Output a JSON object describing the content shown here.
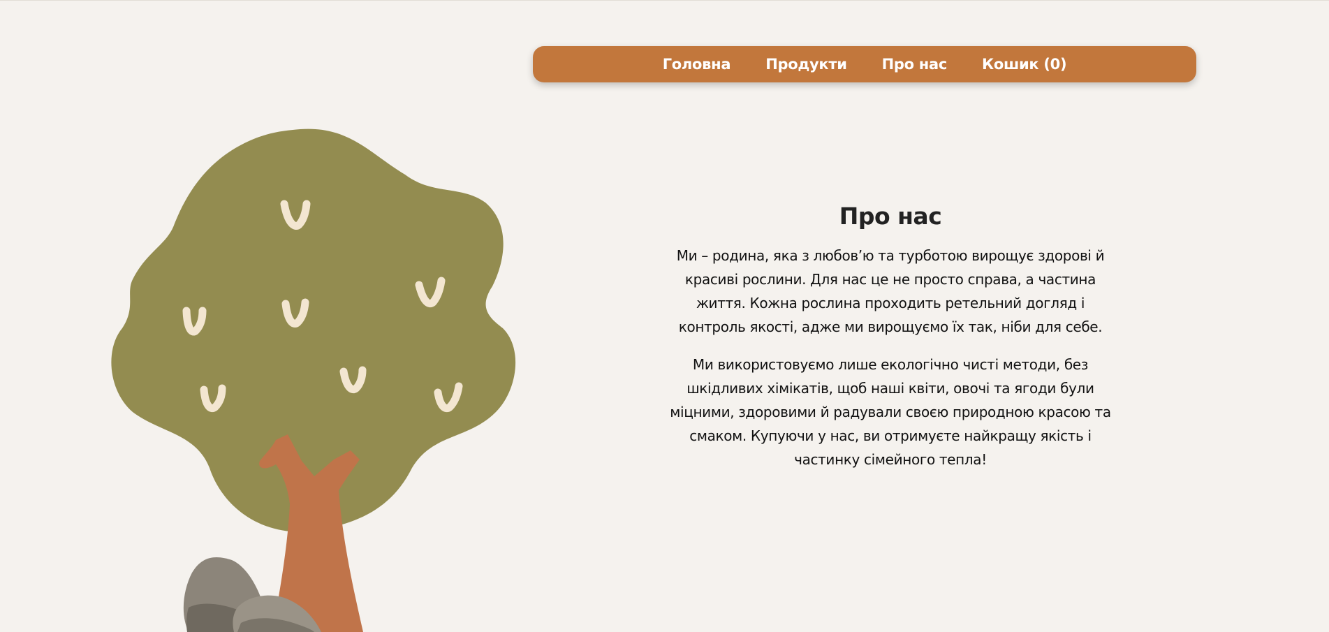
{
  "nav": {
    "items": [
      {
        "label": "Головна"
      },
      {
        "label": "Продукти"
      },
      {
        "label": "Про нас"
      },
      {
        "label": "Кошик (0)"
      }
    ]
  },
  "about": {
    "title": "Про нас",
    "paragraphs": [
      "Ми – родина, яка з любов’ю та турботою вирощує здорові й красиві рослини. Для нас це не просто справа, а частина життя. Кожна рослина проходить ретельний догляд і контроль якості, адже ми вирощуємо їх так, ніби для себе.",
      "Ми використовуємо лише екологічно чисті методи, без шкідливих хімікатів, щоб наші квіти, овочі та ягоди були міцними, здоровими й радували своєю природною красою та смаком. Купуючи у нас, ви отримуєте найкращу якість і частинку сімейного тепла!"
    ]
  },
  "colors": {
    "background": "#f5f2ee",
    "nav_bg": "#c2773c",
    "tree_crown": "#938c50",
    "tree_trunk": "#c0744a",
    "leaf_mark": "#f3e6d1",
    "rock": "#8c857a"
  },
  "illustration": {
    "name": "tree-illustration"
  }
}
